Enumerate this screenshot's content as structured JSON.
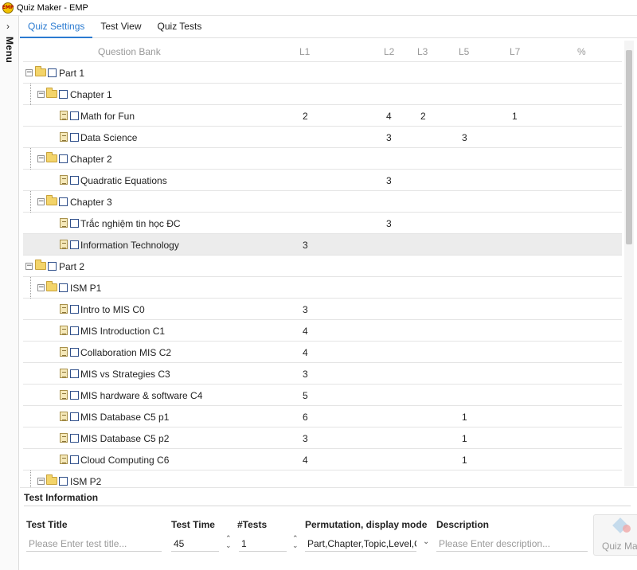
{
  "window": {
    "title": "Quiz Maker - EMP",
    "icon_text": "EMP"
  },
  "sidebar": {
    "chevron": "›",
    "label": "Menu"
  },
  "tabs": [
    {
      "label": "Quiz Settings",
      "active": true
    },
    {
      "label": "Test View",
      "active": false
    },
    {
      "label": "Quiz Tests",
      "active": false
    }
  ],
  "grid": {
    "columns": {
      "name": "Question Bank",
      "l1": "L1",
      "l2": "L2",
      "l3": "L3",
      "l5": "L5",
      "l7": "L7",
      "pct": "%"
    },
    "rows": [
      {
        "name": "Part 1",
        "l1": "",
        "l2": "",
        "l3": "",
        "l5": "",
        "l7": ""
      },
      {
        "name": "Chapter 1",
        "l1": "",
        "l2": "",
        "l3": "",
        "l5": "",
        "l7": ""
      },
      {
        "name": "Math for Fun",
        "l1": "2",
        "l2": "4",
        "l3": "2",
        "l5": "",
        "l7": "1"
      },
      {
        "name": "Data Science",
        "l1": "",
        "l2": "3",
        "l3": "",
        "l5": "3",
        "l7": ""
      },
      {
        "name": "Chapter 2",
        "l1": "",
        "l2": "",
        "l3": "",
        "l5": "",
        "l7": ""
      },
      {
        "name": "Quadratic Equations",
        "l1": "",
        "l2": "3",
        "l3": "",
        "l5": "",
        "l7": ""
      },
      {
        "name": "Chapter 3",
        "l1": "",
        "l2": "",
        "l3": "",
        "l5": "",
        "l7": ""
      },
      {
        "name": "Trắc nghiệm tin học ĐC",
        "l1": "",
        "l2": "3",
        "l3": "",
        "l5": "",
        "l7": ""
      },
      {
        "name": "Information Technology",
        "l1": "3",
        "l2": "",
        "l3": "",
        "l5": "",
        "l7": ""
      },
      {
        "name": "Part 2",
        "l1": "",
        "l2": "",
        "l3": "",
        "l5": "",
        "l7": ""
      },
      {
        "name": "ISM P1",
        "l1": "",
        "l2": "",
        "l3": "",
        "l5": "",
        "l7": ""
      },
      {
        "name": "Intro to MIS C0",
        "l1": "3",
        "l2": "",
        "l3": "",
        "l5": "",
        "l7": ""
      },
      {
        "name": "MIS Introduction C1",
        "l1": "4",
        "l2": "",
        "l3": "",
        "l5": "",
        "l7": ""
      },
      {
        "name": "Collaboration MIS C2",
        "l1": "4",
        "l2": "",
        "l3": "",
        "l5": "",
        "l7": ""
      },
      {
        "name": "MIS vs Strategies C3",
        "l1": "3",
        "l2": "",
        "l3": "",
        "l5": "",
        "l7": ""
      },
      {
        "name": "MIS hardware & software C4",
        "l1": "5",
        "l2": "",
        "l3": "",
        "l5": "",
        "l7": ""
      },
      {
        "name": "MIS Database C5 p1",
        "l1": "6",
        "l2": "",
        "l3": "",
        "l5": "1",
        "l7": ""
      },
      {
        "name": "MIS Database C5 p2",
        "l1": "3",
        "l2": "",
        "l3": "",
        "l5": "1",
        "l7": ""
      },
      {
        "name": "Cloud Computing C6",
        "l1": "4",
        "l2": "",
        "l3": "",
        "l5": "1",
        "l7": ""
      },
      {
        "name": "ISM P2",
        "l1": "",
        "l2": "",
        "l3": "",
        "l5": "",
        "l7": ""
      }
    ]
  },
  "test_info": {
    "title": "Test Information",
    "headers": {
      "title": "Test Title",
      "time": "Test Time",
      "tests": "#Tests",
      "perm": "Permutation, display mode",
      "desc": "Description"
    },
    "test_title_placeholder": "Please Enter test title...",
    "test_time": "45",
    "tests_count": "1",
    "permutation": "Part,Chapter,Topic,Level,Q",
    "description_placeholder": "Please Enter description...",
    "spin_up": "⌃",
    "spin_down": "⌄",
    "dropdown_chevron": "⌄"
  },
  "quiz_button": {
    "label": "Quiz Ma"
  }
}
